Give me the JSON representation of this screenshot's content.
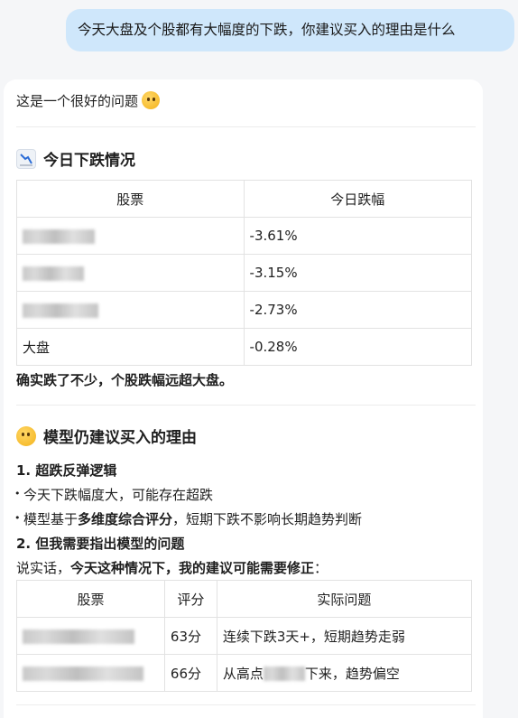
{
  "user_message": "今天大盘及个股都有大幅度的下跌，你建议买入的理由是什么",
  "answer": {
    "intro": "这是一个很好的问题",
    "section1": {
      "icon": "chart-decreasing-icon",
      "title": "今日下跌情况",
      "table": {
        "headers": [
          "股票",
          "今日跌幅"
        ],
        "rows": [
          {
            "name": "",
            "change": "-3.61%"
          },
          {
            "name": "",
            "change": "-3.15%"
          },
          {
            "name": "",
            "change": "-2.73%"
          },
          {
            "name": "大盘",
            "change": "-0.28%"
          }
        ]
      },
      "summary": "确实跌了不少，个股跌幅远超大盘。"
    },
    "section2": {
      "icon": "thinking-face-icon",
      "title": "模型仍建议买入的理由",
      "point1_title": "1. 超跌反弹逻辑",
      "bullet1": "今天下跌幅度大，可能存在超跌",
      "bullet2_pre": "模型基于",
      "bullet2_bold": "多维度综合评分",
      "bullet2_post": "，短期下跌不影响长期趋势判断",
      "point2_title": "2. 但我需要指出模型的问题",
      "honest_pre": "说实话，",
      "honest_bold": "今天这种情况下，我的建议可能需要修正",
      "honest_post": "：",
      "table": {
        "headers": [
          "股票",
          "评分",
          "实际问题"
        ],
        "rows": [
          {
            "name": "",
            "score": "63分",
            "issue": "连续下跌3天+，短期趋势走弱"
          },
          {
            "name": "",
            "score": "66分",
            "issue_pre": "从高点",
            "issue_post": "下来，趋势偏空"
          }
        ]
      }
    }
  }
}
